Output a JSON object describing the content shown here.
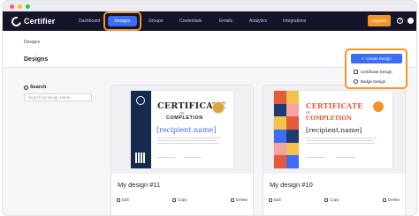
{
  "app": {
    "brand": "Certifier"
  },
  "nav": {
    "items": [
      "Dashboard",
      "Designs",
      "Groups",
      "Credentials",
      "Emails",
      "Analytics",
      "Integrations"
    ],
    "active": "Designs",
    "upgrade_label": "Upgrade",
    "help_glyph": "?"
  },
  "header": {
    "breadcrumb": "Designs",
    "title": "Designs"
  },
  "create_menu": {
    "button_label": "Create Design",
    "plus_glyph": "+",
    "items": [
      "Certificate Design",
      "Badge Design"
    ]
  },
  "search": {
    "title": "Search",
    "placeholder": "Search by design name"
  },
  "cards": [
    {
      "name": "My design #11",
      "preview": {
        "title": "CERTIFICATE",
        "of": "OF",
        "subtitle": "COMPLETION",
        "recipient": "[recipient.name]"
      },
      "actions": [
        "Edit",
        "Copy",
        "Delete"
      ]
    },
    {
      "name": "My design #10",
      "preview": {
        "title": "CERTIFICATE",
        "of": "OF",
        "subtitle": "COMPLETION",
        "recipient": "[recipient.name]"
      },
      "actions": [
        "Edit",
        "Copy",
        "Delete"
      ]
    }
  ],
  "colors": {
    "nav_bg": "#15152a",
    "accent_blue": "#3d6cf5",
    "highlight_orange": "#f2952a",
    "cert2_accent": "#e35b3b"
  },
  "icons": {
    "window_dots": [
      "close-dot",
      "minimize-dot",
      "maximize-dot"
    ],
    "help": "help-icon",
    "search": "search-icon",
    "edit": "pencil-icon",
    "copy": "copy-icon",
    "delete": "trash-icon",
    "certificate": "certificate-icon",
    "badge": "badge-icon"
  }
}
